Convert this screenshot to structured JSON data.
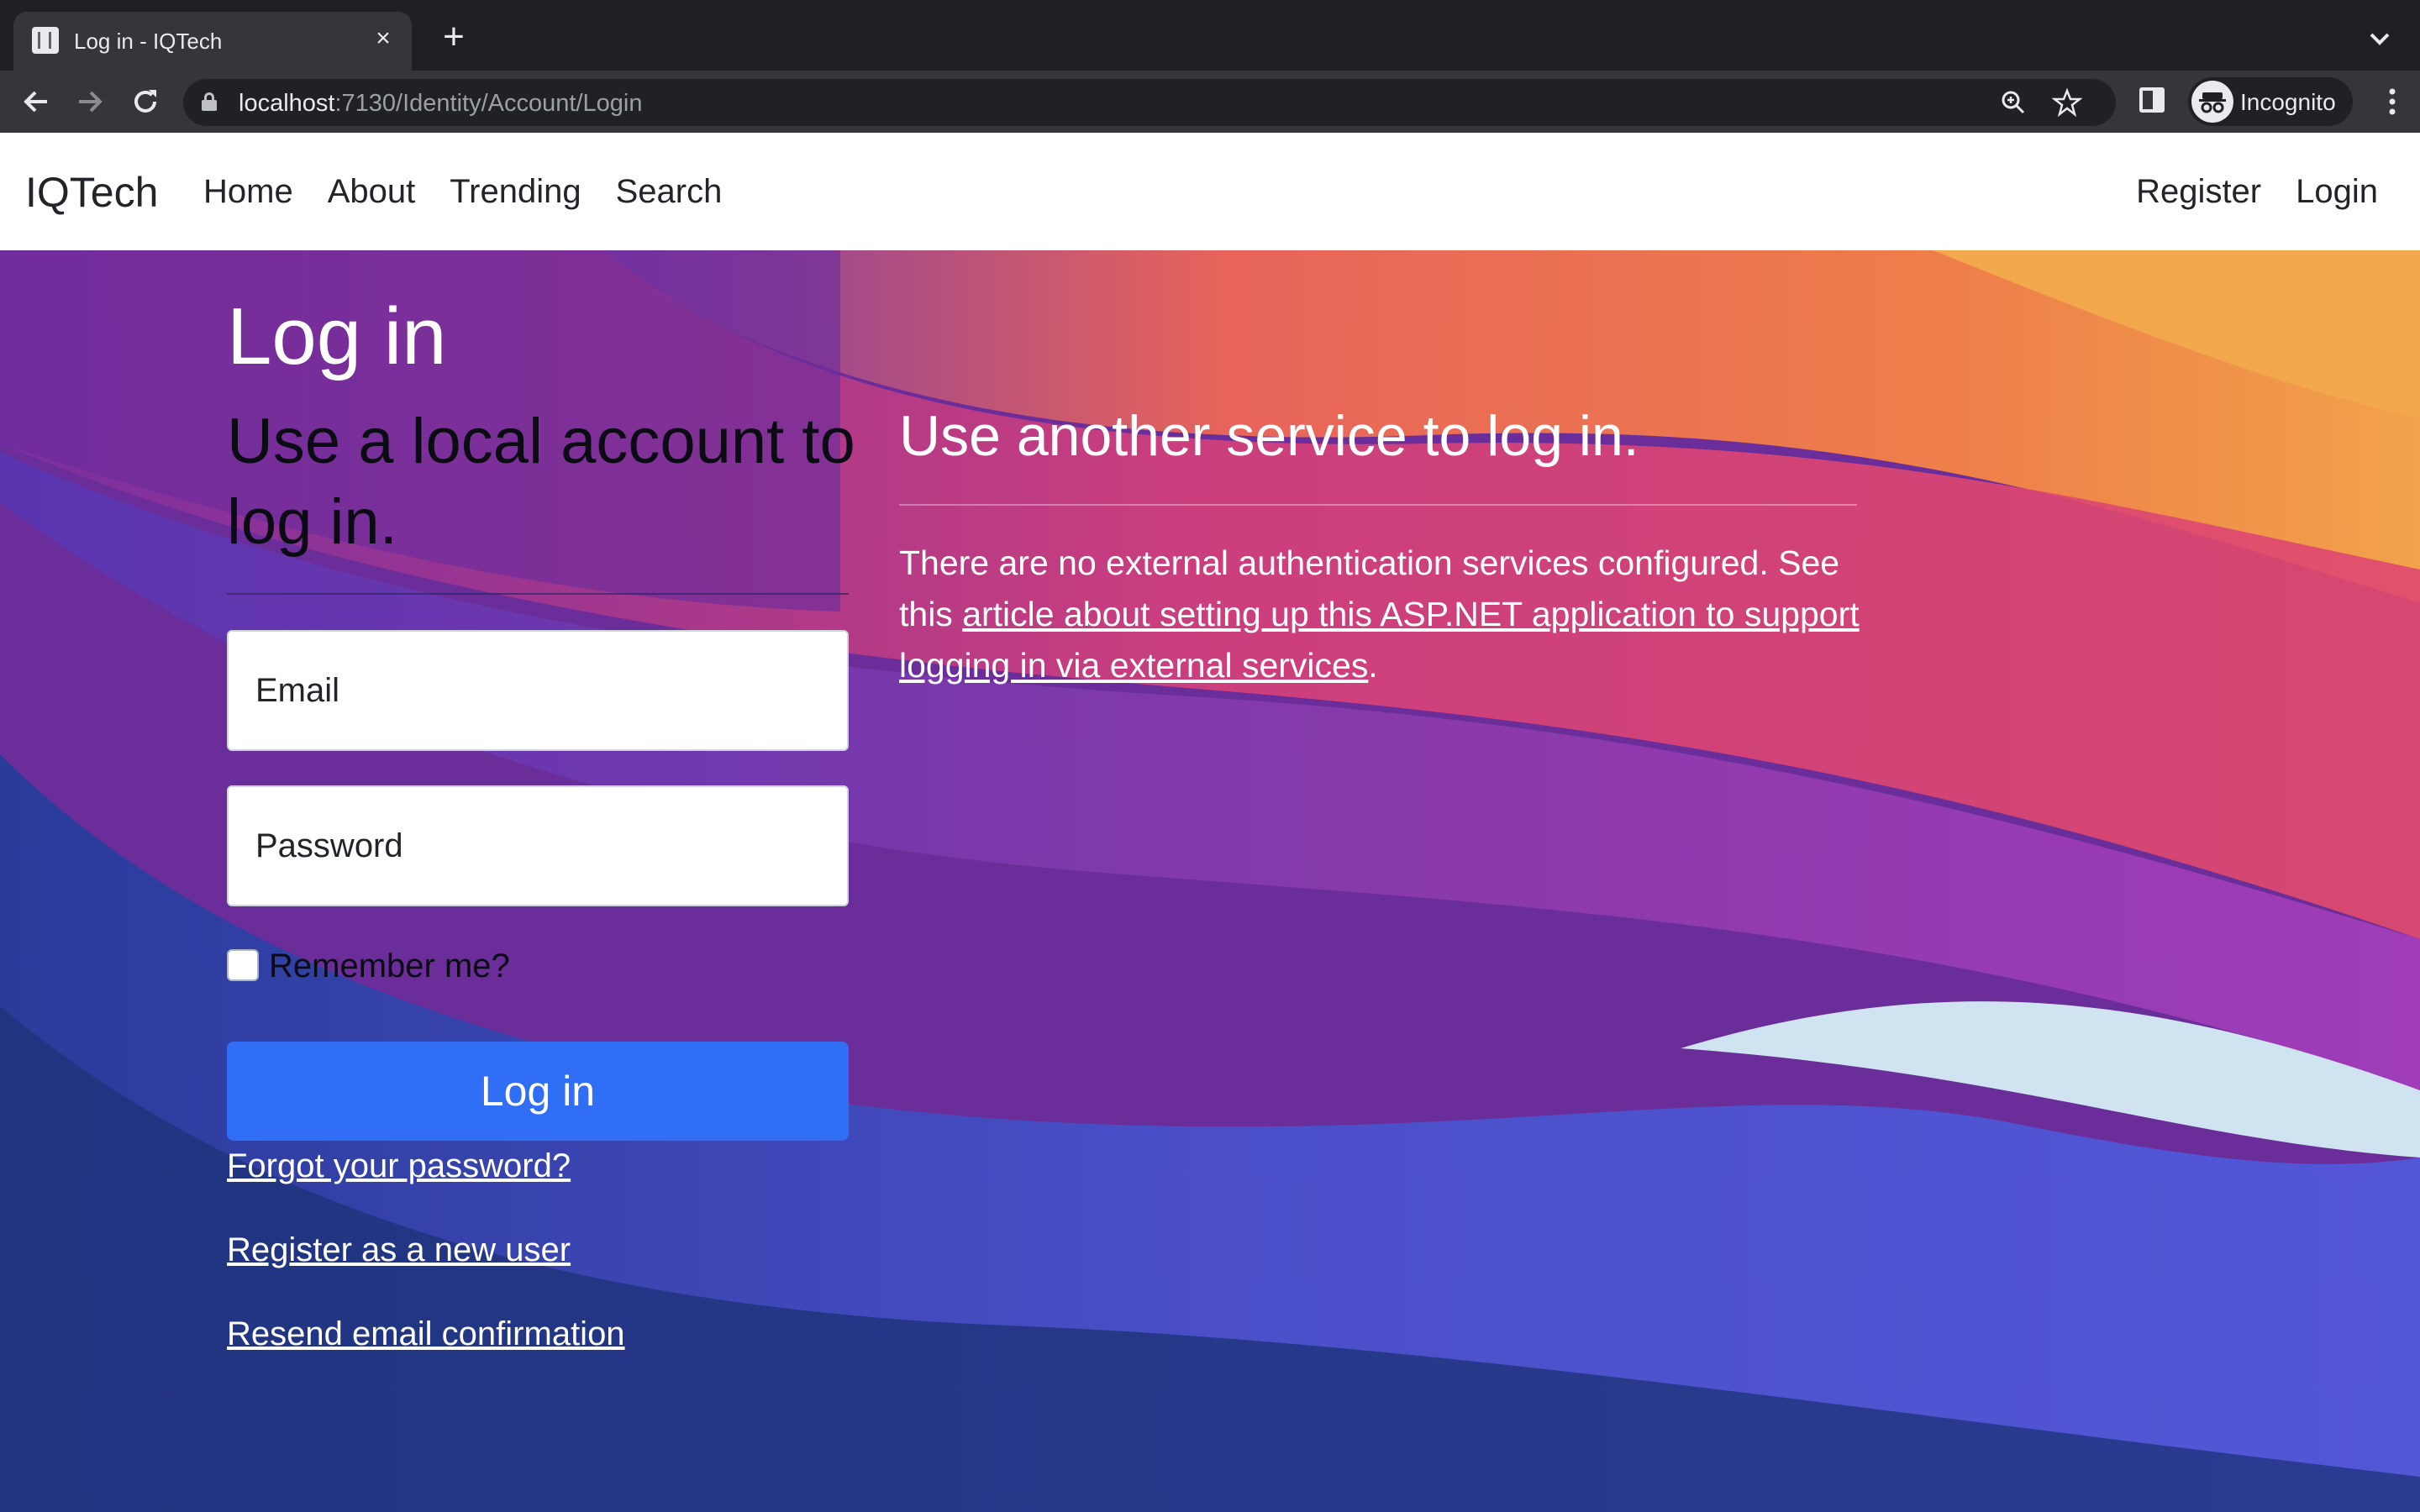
{
  "browser": {
    "tab_title": "Log in - IQTech",
    "close_glyph": "×",
    "new_tab_glyph": "+",
    "url_host": "localhost",
    "url_path": ":7130/Identity/Account/Login",
    "profile_label": "Incognito"
  },
  "navbar": {
    "brand": "IQTech",
    "links": [
      "Home",
      "About",
      "Trending",
      "Search"
    ],
    "right_links": [
      "Register",
      "Login"
    ]
  },
  "page": {
    "title": "Log in",
    "local_heading": "Use a local account to log in.",
    "email_placeholder": "Email",
    "password_placeholder": "Password",
    "remember_label": "Remember me?",
    "login_button": "Log in",
    "forgot_link": "Forgot your password?",
    "register_link": "Register as a new user",
    "resend_link": "Resend email confirmation",
    "external_heading": "Use another service to log in.",
    "external_text_before": "There are no external authentication services configured. See this ",
    "external_link": "article about setting up this ASP.NET application to support logging in via external services",
    "external_text_after": "."
  },
  "colors": {
    "primary_button": "#2f6ef5",
    "navbar_bg": "#ffffff",
    "chrome_bg": "#202124"
  }
}
